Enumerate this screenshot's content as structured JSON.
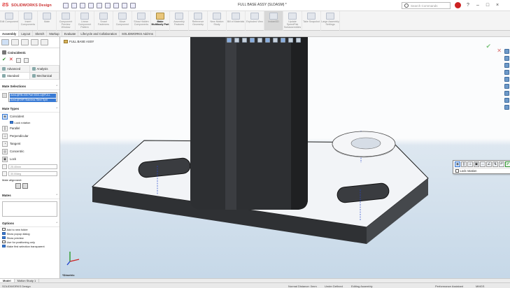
{
  "app": {
    "brand": "SOLIDWORKS Design",
    "document_title": "FULL BASE ASSY (SLDASM) *",
    "search_placeholder": "Search Commands"
  },
  "ribbon": [
    {
      "label": "Edit Component"
    },
    {
      "label": "Insert Components"
    },
    {
      "label": "Mate"
    },
    {
      "label": "Component Preview Window"
    },
    {
      "label": "Linear Component Pattern"
    },
    {
      "label": "Smart Fasteners"
    },
    {
      "label": "Move Component"
    },
    {
      "label": "Show Hidden Components"
    },
    {
      "label": "Make Multibody Part",
      "active": true
    },
    {
      "label": "Assembly Features"
    },
    {
      "label": "Reference Geometry"
    },
    {
      "label": "New Motion Study"
    },
    {
      "label": "Bill of Materials"
    },
    {
      "label": "Exploded View"
    },
    {
      "label": "Instant3D",
      "instant": true
    },
    {
      "label": "Update SpeedPak Subassemblies"
    },
    {
      "label": "Take Snapshot"
    },
    {
      "label": "Large Assembly Settings"
    }
  ],
  "command_tabs": [
    "Assembly",
    "Layout",
    "Sketch",
    "Markup",
    "Evaluate",
    "Lifecycle and Collaboration",
    "SOLIDWORKS Add-Ins"
  ],
  "property_manager": {
    "title": "Coincident1",
    "subtabs": [
      {
        "label": "Advanced"
      },
      {
        "label": "Analysis"
      },
      {
        "label": "Standard",
        "active": true
      },
      {
        "label": "Mechanical"
      }
    ],
    "mate_selections_header": "Mate Selections",
    "selections": [
      "Axis1@RB-005 Part 0003-1@FULL",
      "Axis1@SHR Stainless Steel Split"
    ],
    "mate_types_header": "Mate Types",
    "mate_types": [
      {
        "label": "Coincident",
        "icon": "coincident-icon",
        "active": true
      },
      {
        "label": "Parallel",
        "icon": "parallel-icon"
      },
      {
        "label": "Perpendicular",
        "icon": "perpendicular-icon"
      },
      {
        "label": "Tangent",
        "icon": "tangent-icon"
      },
      {
        "label": "Concentric",
        "icon": "concentric-icon"
      },
      {
        "label": "Lock",
        "icon": "lock-icon"
      }
    ],
    "lock_rotation_label": "Lock rotation",
    "distance_value": "25.40mm",
    "angle_value": "30.00deg",
    "mate_alignment_label": "Mate alignment:",
    "mates_header": "Mates",
    "options_header": "Options",
    "options": [
      {
        "label": "Add to new folder",
        "checked": false
      },
      {
        "label": "Show popup dialog",
        "checked": true
      },
      {
        "label": "Show preview",
        "checked": true
      },
      {
        "label": "Use for positioning only",
        "checked": false
      },
      {
        "label": "Make first selection transparent",
        "checked": true
      }
    ]
  },
  "graphics": {
    "tree_root": "FULL BASE ASSY",
    "context_toolbar_check": "Lock rotation",
    "scale_label": "*Dimetric"
  },
  "bottom_tabs": [
    "Model",
    "Motion Study 1"
  ],
  "status": {
    "app": "SOLIDWORKS Design",
    "distance": "Normal Distance: 0mm",
    "defined": "Under Defined",
    "editing": "Editing Assembly",
    "perf": "Performance Assistant",
    "units": "MMGS"
  },
  "colors": {
    "brand": "#cc2222",
    "selection": "#3a7bd5",
    "model_face": "#f2f4f7",
    "model_shade": "#3c3e42"
  }
}
